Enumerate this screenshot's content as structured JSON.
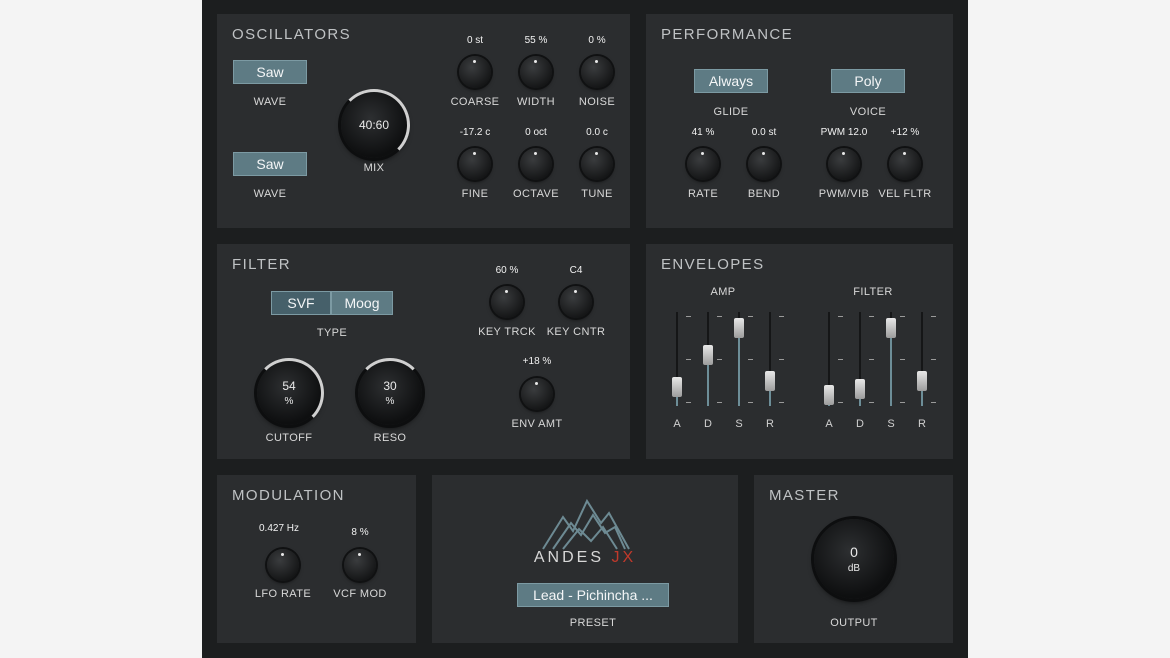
{
  "oscillators": {
    "title": "OSCILLATORS",
    "wave1": {
      "value": "Saw",
      "label": "WAVE"
    },
    "wave2": {
      "value": "Saw",
      "label": "WAVE"
    },
    "mix": {
      "value": "40:60",
      "label": "MIX"
    },
    "knobs": [
      {
        "id": "coarse",
        "value": "0 st",
        "label": "COARSE"
      },
      {
        "id": "width",
        "value": "55 %",
        "label": "WIDTH"
      },
      {
        "id": "noise",
        "value": "0 %",
        "label": "NOISE"
      },
      {
        "id": "fine",
        "value": "-17.2 c",
        "label": "FINE"
      },
      {
        "id": "octave",
        "value": "0 oct",
        "label": "OCTAVE"
      },
      {
        "id": "tune",
        "value": "0.0 c",
        "label": "TUNE"
      }
    ]
  },
  "performance": {
    "title": "PERFORMANCE",
    "glide": {
      "value": "Always",
      "label": "GLIDE"
    },
    "voice": {
      "value": "Poly",
      "label": "VOICE"
    },
    "knobs": [
      {
        "id": "rate",
        "value": "41 %",
        "label": "RATE"
      },
      {
        "id": "bend",
        "value": "0.0 st",
        "label": "BEND"
      },
      {
        "id": "pwmvib",
        "value": "PWM 12.0",
        "label": "PWM/VIB"
      },
      {
        "id": "velfltr",
        "value": "+12 %",
        "label": "VEL FLTR"
      }
    ]
  },
  "filter": {
    "title": "FILTER",
    "type_options": [
      "SVF",
      "Moog"
    ],
    "type_selected": "Moog",
    "type_label": "TYPE",
    "cutoff": {
      "value": "54",
      "unit": "%",
      "label": "CUTOFF"
    },
    "reso": {
      "value": "30",
      "unit": "%",
      "label": "RESO"
    },
    "knobs": [
      {
        "id": "keytrck",
        "value": "60 %",
        "label": "KEY TRCK"
      },
      {
        "id": "keycntr",
        "value": "C4",
        "label": "KEY CNTR"
      },
      {
        "id": "envamt",
        "value": "+18 %",
        "label": "ENV AMT"
      }
    ]
  },
  "envelopes": {
    "title": "ENVELOPES",
    "amp": {
      "label": "AMP",
      "stages": [
        "A",
        "D",
        "S",
        "R"
      ],
      "levels": [
        0.12,
        0.55,
        0.92,
        0.2
      ]
    },
    "filter": {
      "label": "FILTER",
      "stages": [
        "A",
        "D",
        "S",
        "R"
      ],
      "levels": [
        0.02,
        0.1,
        0.92,
        0.2
      ]
    }
  },
  "modulation": {
    "title": "MODULATION",
    "knobs": [
      {
        "id": "lforate",
        "value": "0.427 Hz",
        "label": "LFO RATE"
      },
      {
        "id": "vcfmod",
        "value": "8 %",
        "label": "VCF MOD"
      }
    ]
  },
  "center": {
    "logo_text_main": "ANDES",
    "logo_text_accent": "JX",
    "preset_value": "Lead - Pichincha ...",
    "preset_label": "PRESET"
  },
  "master": {
    "title": "MASTER",
    "output": {
      "value": "0",
      "unit": "dB",
      "label": "OUTPUT"
    }
  }
}
